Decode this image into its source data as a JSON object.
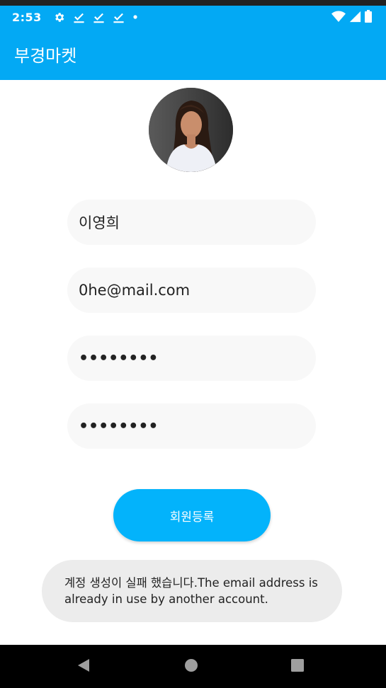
{
  "status_bar": {
    "time": "2:53",
    "icons_left": [
      "gear-icon",
      "check-download-icon",
      "check-download-icon",
      "check-download-icon",
      "dot-icon"
    ],
    "icons_right": [
      "wifi-icon",
      "cell-signal-icon",
      "battery-icon"
    ]
  },
  "app_bar": {
    "title": "부경마켓"
  },
  "form": {
    "name_value": "이영희",
    "email_value": "0he@mail.com",
    "password_value": "••••••••",
    "password_confirm_value": "••••••••"
  },
  "register_button": {
    "label": "회원등록"
  },
  "toast": {
    "message": "계정 생성이 실패 했습니다.The email address is already in use by another account."
  },
  "colors": {
    "primary": "#03a9f4",
    "button": "#03b3fb",
    "field_bg": "#f8f8f8",
    "toast_bg": "#ececec"
  },
  "nav_bar": {
    "icons": [
      "back-icon",
      "home-icon",
      "recents-icon"
    ]
  }
}
